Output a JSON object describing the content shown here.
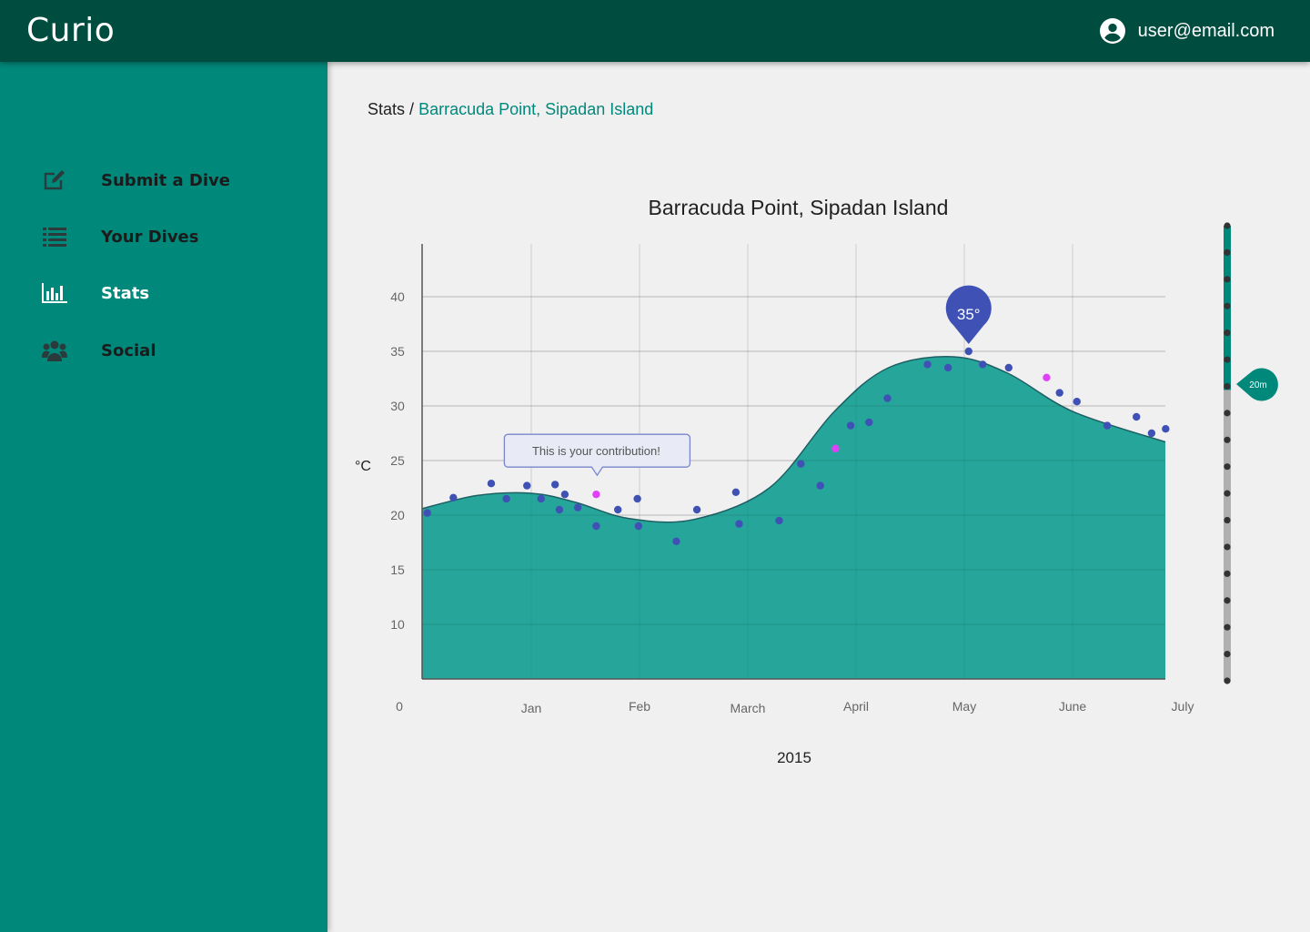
{
  "app": {
    "brand": "Curio",
    "user_email": "user@email.com"
  },
  "sidebar": {
    "items": [
      {
        "label": "Submit a Dive",
        "icon": "edit-icon"
      },
      {
        "label": "Your Dives",
        "icon": "list-icon"
      },
      {
        "label": "Stats",
        "icon": "bar-chart-icon"
      },
      {
        "label": "Social",
        "icon": "group-icon"
      }
    ]
  },
  "breadcrumb": {
    "root": "Stats",
    "separator": "/",
    "current": "Barracuda Point, Sipadan Island"
  },
  "colors": {
    "header": "#004d40",
    "sidebar": "#00897b",
    "area_fill": "#26a69a",
    "point": "#3f51b5",
    "contribution_point": "#e040fb",
    "depth_active": "#00897b",
    "depth_inactive": "#b0b0b0"
  },
  "chart_data": {
    "type": "scatter",
    "title": "Barracuda Point, Sipadan Island",
    "xlabel": "2015",
    "ylabel": "°C",
    "yticks": [
      10,
      15,
      20,
      25,
      30,
      35,
      40
    ],
    "y_zero_label": "0",
    "ylim": [
      0,
      45
    ],
    "xticks": [
      "Jan",
      "Feb",
      "March",
      "April",
      "May",
      "June",
      "July"
    ],
    "xlim": [
      0,
      6.9
    ],
    "grid": true,
    "trend_line": {
      "x": [
        0,
        0.5,
        1,
        1.4,
        1.9,
        2.5,
        3.2,
        3.8,
        4.3,
        4.9,
        5.4,
        6.0,
        6.9
      ],
      "y": [
        20.6,
        21.8,
        22.0,
        21.2,
        19.7,
        19.6,
        22.5,
        29.5,
        33.5,
        34.5,
        33.0,
        29.5,
        26.7
      ]
    },
    "points": [
      {
        "x": 0.04,
        "y": 20.2
      },
      {
        "x": 0.28,
        "y": 21.6
      },
      {
        "x": 0.63,
        "y": 22.9
      },
      {
        "x": 0.77,
        "y": 21.5
      },
      {
        "x": 0.96,
        "y": 22.7
      },
      {
        "x": 1.09,
        "y": 21.5
      },
      {
        "x": 1.22,
        "y": 22.8
      },
      {
        "x": 1.26,
        "y": 20.5
      },
      {
        "x": 1.31,
        "y": 21.9
      },
      {
        "x": 1.43,
        "y": 20.7
      },
      {
        "x": 1.6,
        "y": 19.0
      },
      {
        "x": 1.8,
        "y": 20.5
      },
      {
        "x": 1.98,
        "y": 21.5
      },
      {
        "x": 1.99,
        "y": 19.0
      },
      {
        "x": 2.34,
        "y": 17.6
      },
      {
        "x": 2.53,
        "y": 20.5
      },
      {
        "x": 2.89,
        "y": 22.1
      },
      {
        "x": 2.92,
        "y": 19.2
      },
      {
        "x": 3.29,
        "y": 19.5
      },
      {
        "x": 3.49,
        "y": 24.7
      },
      {
        "x": 3.67,
        "y": 22.7
      },
      {
        "x": 3.95,
        "y": 28.2
      },
      {
        "x": 4.12,
        "y": 28.5
      },
      {
        "x": 4.29,
        "y": 30.7
      },
      {
        "x": 4.66,
        "y": 33.8
      },
      {
        "x": 4.85,
        "y": 33.5
      },
      {
        "x": 5.04,
        "y": 35.0
      },
      {
        "x": 5.17,
        "y": 33.8
      },
      {
        "x": 5.41,
        "y": 33.5
      },
      {
        "x": 5.88,
        "y": 31.2
      },
      {
        "x": 6.04,
        "y": 30.4
      },
      {
        "x": 6.32,
        "y": 28.2
      },
      {
        "x": 6.59,
        "y": 29.0
      },
      {
        "x": 6.73,
        "y": 27.5
      },
      {
        "x": 6.86,
        "y": 27.9
      }
    ],
    "contributions": [
      {
        "x": 1.6,
        "y": 21.9
      },
      {
        "x": 3.81,
        "y": 26.1
      },
      {
        "x": 5.76,
        "y": 32.6
      }
    ],
    "contribution_tooltip": "This is your contribution!",
    "peak_marker": {
      "x": 5.04,
      "y": 35.0,
      "label": "35°"
    },
    "depth_scale": {
      "label": "20m",
      "ticks": 18,
      "selected_index": 6
    }
  }
}
